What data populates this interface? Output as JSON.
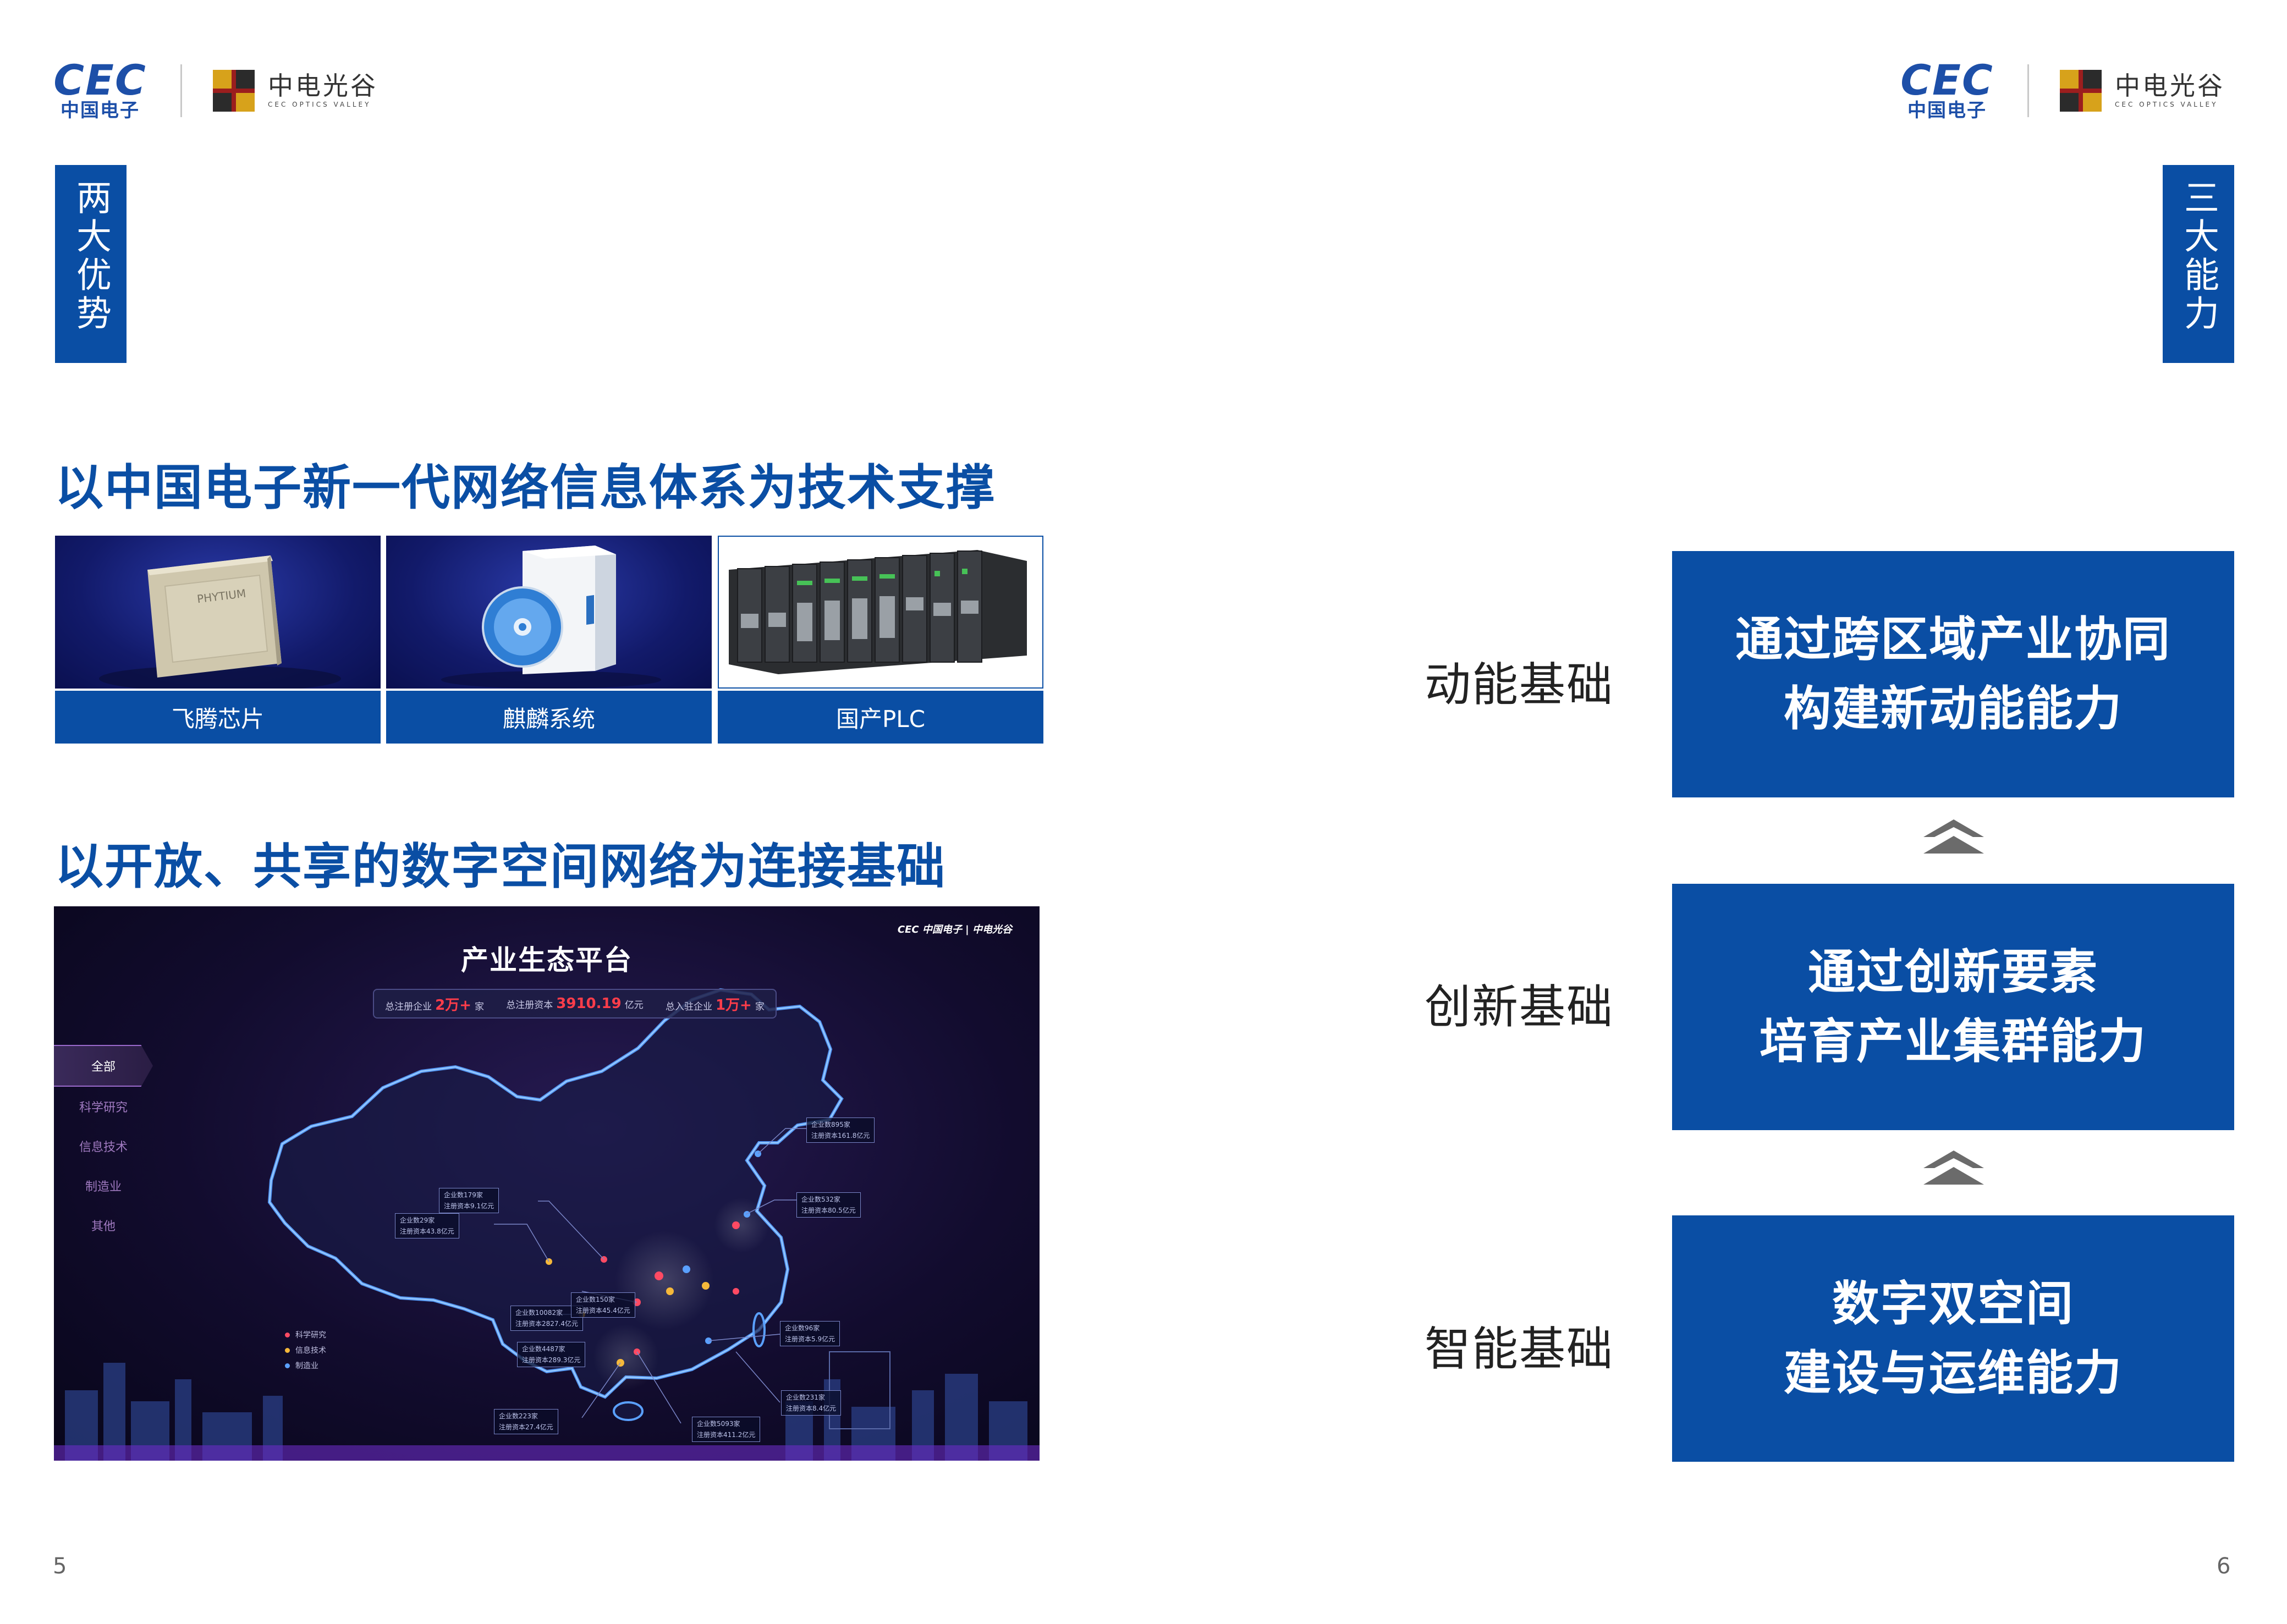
{
  "logos": {
    "cec_mark": "CEC",
    "cec_cn": "中国电子",
    "ov_cn": "中电光谷",
    "ov_en": "CEC OPTICS VALLEY"
  },
  "left_tab": "两大优势",
  "right_tab": "三大能力",
  "section1": {
    "title": "以中国电子新一代网络信息体系为技术支撑",
    "cards": [
      {
        "label": "飞腾芯片",
        "chip_text": "PHYTIUM"
      },
      {
        "label": "麒麟系统"
      },
      {
        "label": "国产PLC"
      }
    ]
  },
  "section2": {
    "title": "以开放、共享的数字空间网络为连接基础"
  },
  "platform": {
    "title": "产业生态平台",
    "corner_logo": "CEC 中国电子 | 中电光谷",
    "stats": {
      "s1_label": "总注册企业",
      "s1_value": "2万+",
      "s1_unit": "家",
      "s2_label": "总注册资本",
      "s2_value": "3910.19",
      "s2_unit": "亿元",
      "s3_label": "总入驻企业",
      "s3_value": "1万+",
      "s3_unit": "家"
    },
    "menu": [
      "全部",
      "科学研究",
      "信息技术",
      "制造业",
      "其他"
    ],
    "legend": [
      "科学研究",
      "信息技术",
      "制造业"
    ],
    "tags": [
      {
        "c": "企业数895家",
        "r": "注册资本161.8亿元"
      },
      {
        "c": "企业数179家",
        "r": "注册资本9.1亿元"
      },
      {
        "c": "企业数29家",
        "r": "注册资本43.8亿元"
      },
      {
        "c": "企业数532家",
        "r": "注册资本80.5亿元"
      },
      {
        "c": "企业数10082家",
        "r": "注册资本2827.4亿元"
      },
      {
        "c": "企业数150家",
        "r": "注册资本45.4亿元"
      },
      {
        "c": "企业数4487家",
        "r": "注册资本289.3亿元"
      },
      {
        "c": "企业数96家",
        "r": "注册资本5.9亿元"
      },
      {
        "c": "企业数231家",
        "r": "注册资本8.4亿元"
      },
      {
        "c": "企业数223家",
        "r": "注册资本27.4亿元"
      },
      {
        "c": "企业数5093家",
        "r": "注册资本411.2亿元"
      }
    ]
  },
  "abilities": [
    {
      "label": "动能基础",
      "line1": "通过跨区域产业协同",
      "line2": "构建新动能能力"
    },
    {
      "label": "创新基础",
      "line1": "通过创新要素",
      "line2": "培育产业集群能力"
    },
    {
      "label": "智能基础",
      "line1": "数字双空间",
      "line2": "建设与运维能力"
    }
  ],
  "colors": {
    "brand_blue": "#0a4ea4",
    "arrow_gray": "#6b6b6b"
  },
  "page_left": "5",
  "page_right": "6"
}
